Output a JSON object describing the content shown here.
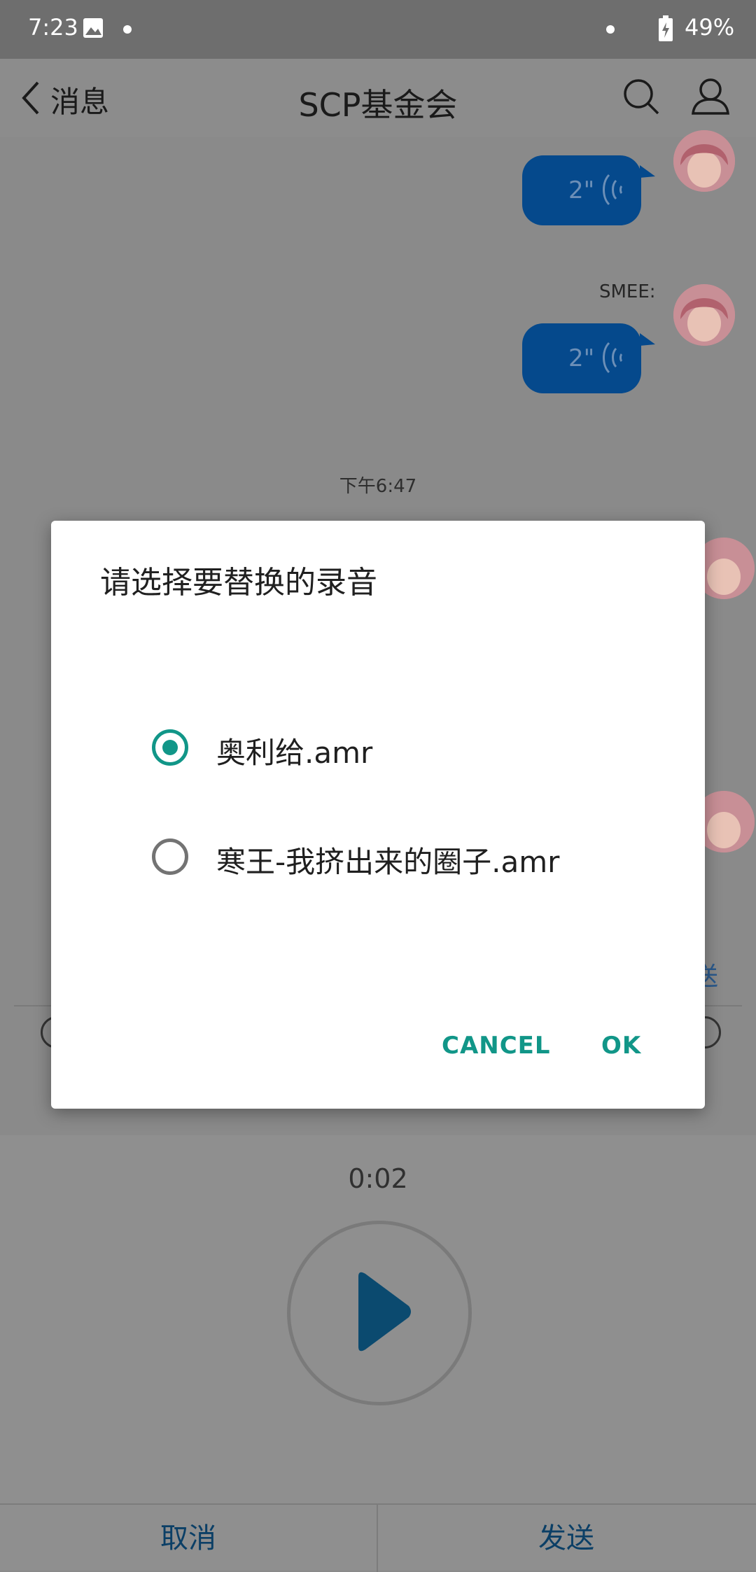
{
  "status_bar": {
    "time": "7:23",
    "battery_percent": "49%"
  },
  "header": {
    "back_label": "消息",
    "title": "SCP基金会"
  },
  "chat": {
    "messages": [
      {
        "duration": "2\""
      },
      {
        "sender": "SMEE:",
        "duration": "2\""
      }
    ],
    "timestamp": "下午6:47",
    "send_hint": "送"
  },
  "recorder": {
    "elapsed": "0:02",
    "cancel_label": "取消",
    "send_label": "发送"
  },
  "dialog": {
    "title": "请选择要替换的录音",
    "options": [
      {
        "label": "奥利给.amr",
        "selected": true
      },
      {
        "label": "寒王-我挤出来的圈子.amr",
        "selected": false
      }
    ],
    "cancel_label": "CANCEL",
    "ok_label": "OK"
  },
  "colors": {
    "accent": "#119688",
    "bubble": "#05498c",
    "play": "#0b4a6f"
  }
}
